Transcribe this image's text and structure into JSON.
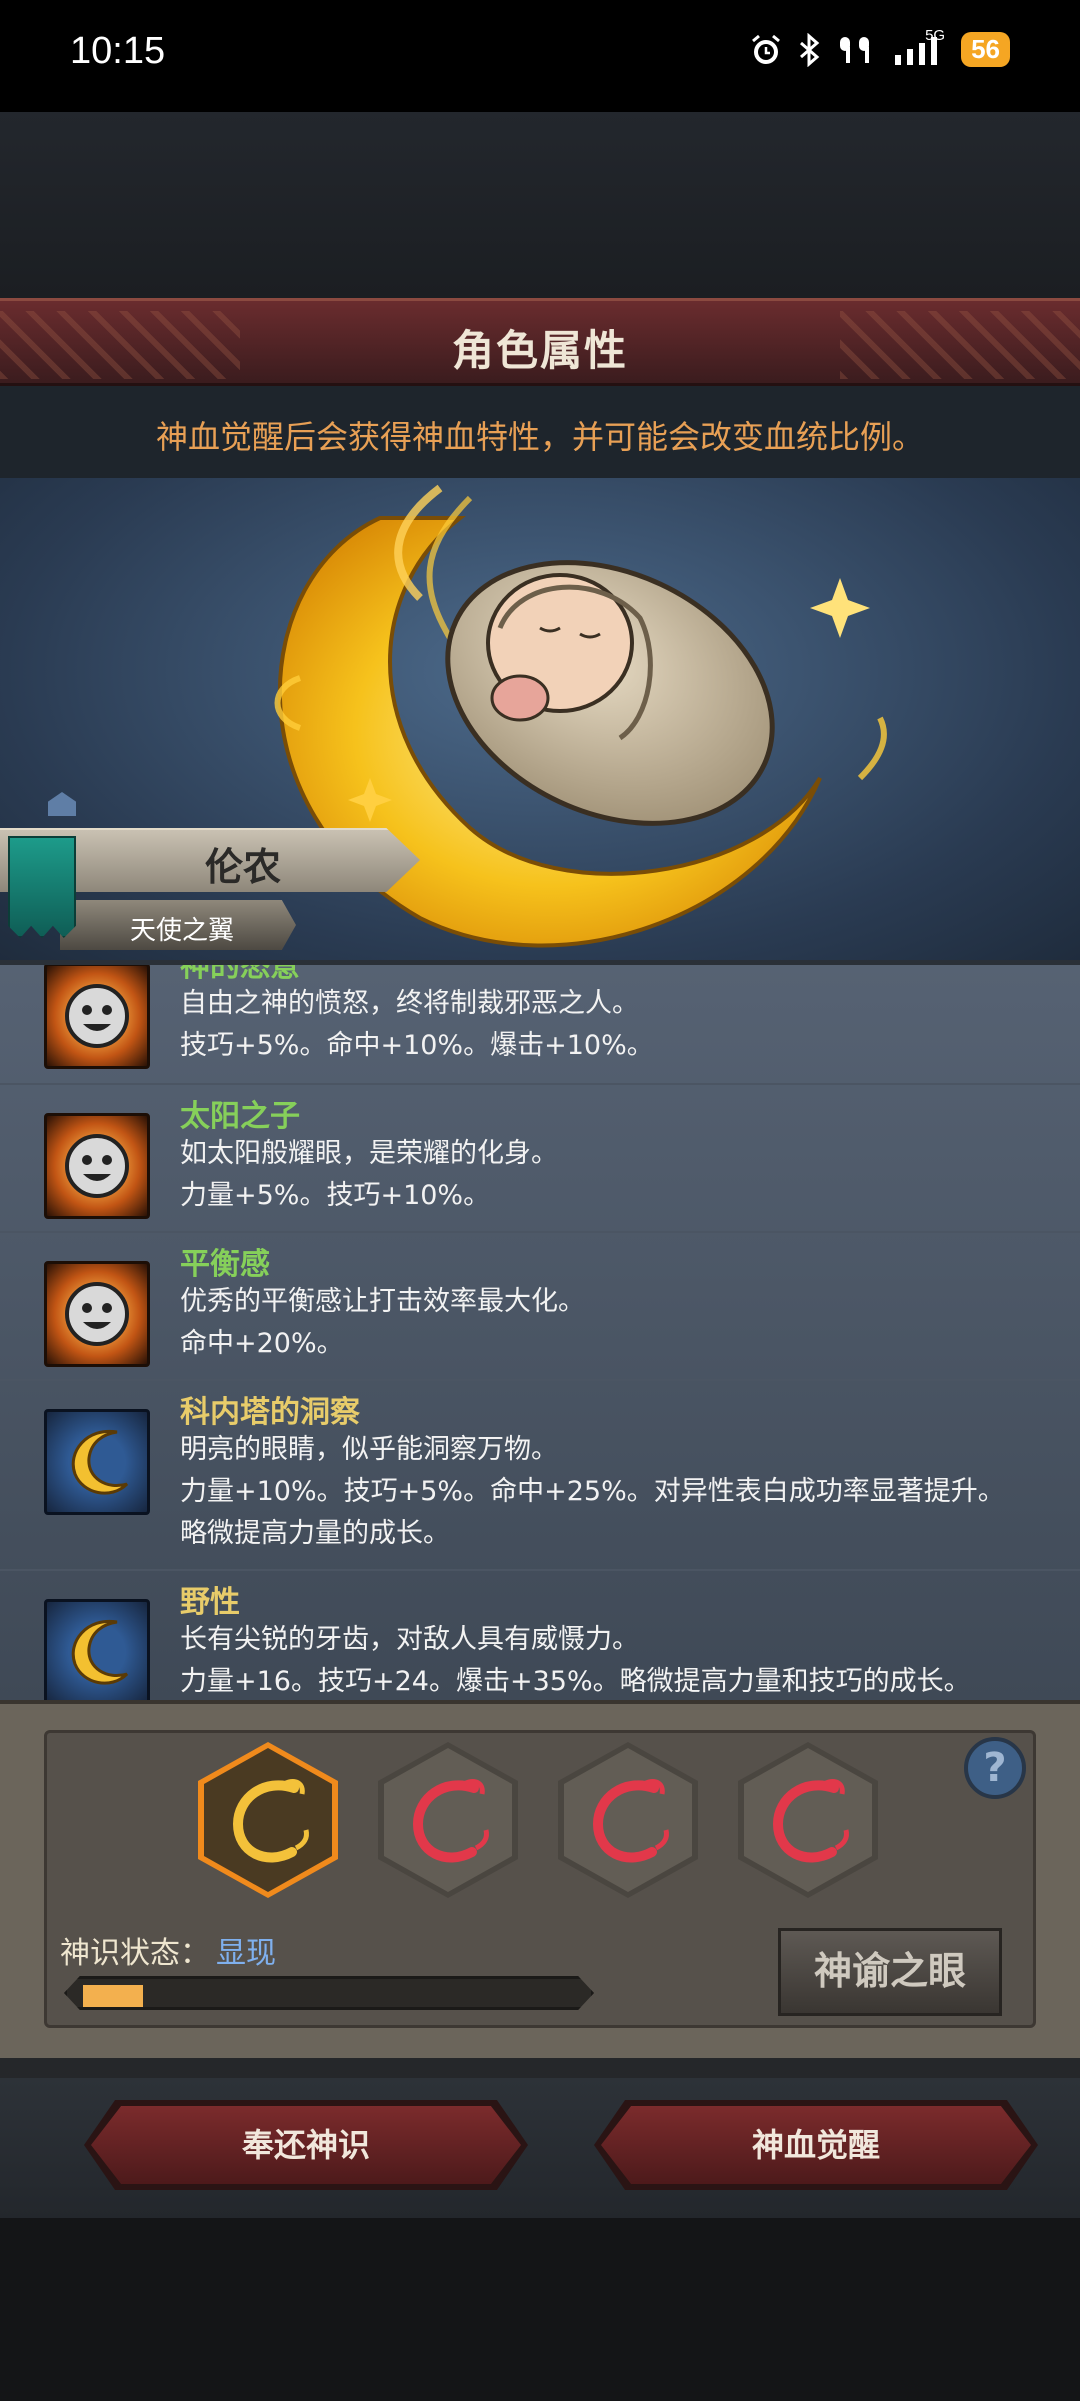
{
  "status": {
    "time": "10:15",
    "network": "5G",
    "battery": "56"
  },
  "screen": {
    "title": "角色属性",
    "subtitle": "神血觉醒后会获得神血特性，并可能会改变血统比例。"
  },
  "character": {
    "name": "伦农",
    "title": "天使之翼"
  },
  "traits": [
    {
      "name": "神的怒意",
      "name_color": "#86d05a",
      "icon": "smiley-sun-icon",
      "lines": [
        "自由之神的愤怒，终将制裁邪恶之人。",
        "技巧+5%。命中+10%。爆击+10%。"
      ]
    },
    {
      "name": "太阳之子",
      "name_color": "#86d05a",
      "icon": "smiley-sun-icon",
      "lines": [
        "如太阳般耀眼，是荣耀的化身。",
        "力量+5%。技巧+10%。"
      ]
    },
    {
      "name": "平衡感",
      "name_color": "#86d05a",
      "icon": "smiley-sun-icon",
      "lines": [
        "优秀的平衡感让打击效率最大化。",
        "命中+20%。"
      ]
    },
    {
      "name": "科内塔的洞察",
      "name_color": "#e8cc6a",
      "icon": "crescent-moon-icon",
      "lines": [
        "明亮的眼睛，似乎能洞察万物。",
        "力量+10%。技巧+5%。命中+25%。对异性表白成功率显著提升。",
        "略微提高力量的成长。"
      ]
    },
    {
      "name": "野性",
      "name_color": "#e8cc6a",
      "icon": "crescent-moon-icon",
      "lines": [
        "长有尖锐的牙齿，对敌人具有威慑力。",
        "力量+16。技巧+24。爆击+35%。略微提高力量和技巧的成长。"
      ]
    }
  ],
  "divine_panel": {
    "slots": [
      {
        "state": "active",
        "icon": "golden-crescent-icon"
      },
      {
        "state": "locked",
        "icon": "red-crescent-icon"
      },
      {
        "state": "locked",
        "icon": "red-crescent-icon"
      },
      {
        "state": "locked",
        "icon": "red-crescent-icon"
      }
    ],
    "help_label": "?",
    "state_label": "神识状态：",
    "state_value": "显现",
    "progress_fraction": 0.12,
    "oracle_button": "神谕之眼"
  },
  "actions": {
    "return_button": "奉还神识",
    "awaken_button": "神血觉醒"
  },
  "colors": {
    "accent_orange": "#e8a055",
    "title_red": "#6a2c2e",
    "progress": "#f3b04e",
    "state_blue": "#7fb0ee"
  }
}
